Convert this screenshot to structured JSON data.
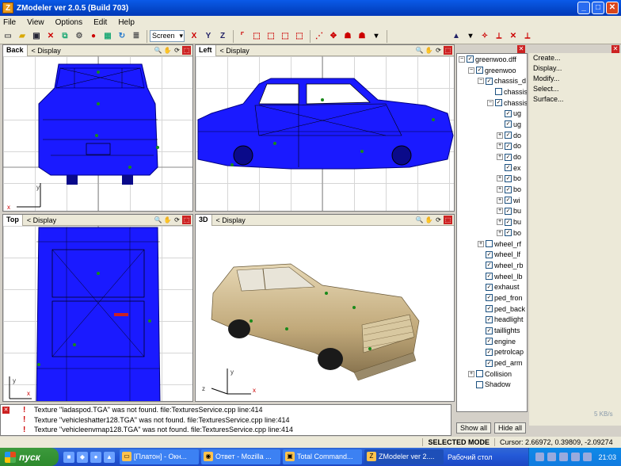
{
  "window": {
    "title": "ZModeler ver 2.0.5 (Build 703)",
    "icon_letter": "Z",
    "btn_min": "_",
    "btn_max": "□",
    "btn_close": "✕"
  },
  "menu": [
    {
      "label": "File"
    },
    {
      "label": "View"
    },
    {
      "label": "Options"
    },
    {
      "label": "Edit"
    },
    {
      "label": "Help"
    }
  ],
  "toolbar": {
    "screen_select": "Screen",
    "axis_x": "X",
    "axis_y": "Y",
    "axis_z": "Z"
  },
  "viewports": {
    "back": {
      "name": "Back",
      "display": "< Display"
    },
    "left": {
      "name": "Left",
      "display": "< Display"
    },
    "top": {
      "name": "Top",
      "display": "< Display"
    },
    "view3d": {
      "name": "3D",
      "display": "< Display"
    }
  },
  "axes": {
    "x": "x",
    "y": "y",
    "z": "z"
  },
  "tree": {
    "rows": [
      {
        "indent": 0,
        "exp": "−",
        "checked": true,
        "label": "greenwoo.dff"
      },
      {
        "indent": 1,
        "exp": "−",
        "checked": true,
        "label": "greenwoo"
      },
      {
        "indent": 2,
        "exp": "−",
        "checked": true,
        "label": "chassis_d"
      },
      {
        "indent": 3,
        "exp": "",
        "checked": false,
        "label": "chassis"
      },
      {
        "indent": 3,
        "exp": "−",
        "checked": true,
        "label": "chassis"
      },
      {
        "indent": 4,
        "exp": "",
        "checked": true,
        "label": "ug"
      },
      {
        "indent": 4,
        "exp": "",
        "checked": true,
        "label": "ug"
      },
      {
        "indent": 4,
        "exp": "+",
        "checked": true,
        "label": "do"
      },
      {
        "indent": 4,
        "exp": "+",
        "checked": true,
        "label": "do"
      },
      {
        "indent": 4,
        "exp": "+",
        "checked": true,
        "label": "do"
      },
      {
        "indent": 4,
        "exp": "",
        "checked": true,
        "label": "ex"
      },
      {
        "indent": 4,
        "exp": "+",
        "checked": true,
        "label": "bo"
      },
      {
        "indent": 4,
        "exp": "+",
        "checked": true,
        "label": "bo"
      },
      {
        "indent": 4,
        "exp": "+",
        "checked": true,
        "label": "wi"
      },
      {
        "indent": 4,
        "exp": "+",
        "checked": true,
        "label": "bu"
      },
      {
        "indent": 4,
        "exp": "+",
        "checked": true,
        "label": "bu"
      },
      {
        "indent": 4,
        "exp": "+",
        "checked": true,
        "label": "bo"
      },
      {
        "indent": 2,
        "exp": "+",
        "checked": false,
        "label": "wheel_rf"
      },
      {
        "indent": 2,
        "exp": "",
        "checked": true,
        "label": "wheel_lf"
      },
      {
        "indent": 2,
        "exp": "",
        "checked": true,
        "label": "wheel_rb"
      },
      {
        "indent": 2,
        "exp": "",
        "checked": true,
        "label": "wheel_lb"
      },
      {
        "indent": 2,
        "exp": "",
        "checked": true,
        "label": "exhaust"
      },
      {
        "indent": 2,
        "exp": "",
        "checked": true,
        "label": "ped_fron"
      },
      {
        "indent": 2,
        "exp": "",
        "checked": true,
        "label": "ped_back"
      },
      {
        "indent": 2,
        "exp": "",
        "checked": true,
        "label": "headlight"
      },
      {
        "indent": 2,
        "exp": "",
        "checked": true,
        "label": "taillights"
      },
      {
        "indent": 2,
        "exp": "",
        "checked": true,
        "label": "engine"
      },
      {
        "indent": 2,
        "exp": "",
        "checked": true,
        "label": "petrolcap"
      },
      {
        "indent": 2,
        "exp": "",
        "checked": true,
        "label": "ped_arm"
      },
      {
        "indent": 1,
        "exp": "+",
        "checked": false,
        "label": "Collision"
      },
      {
        "indent": 1,
        "exp": "",
        "checked": false,
        "label": "Shadow"
      }
    ],
    "show_all": "Show all",
    "hide_all": "Hide all"
  },
  "right_panel": [
    "Create...",
    "Display...",
    "Modify...",
    "Select...",
    "Surface..."
  ],
  "log": [
    "Texture \"ladaspod.TGA\" was not found. file:TexturesService.cpp line:414",
    "Texture \"vehicleshatter128.TGA\" was not found. file:TexturesService.cpp line:414",
    "Texture \"vehicleenvmap128.TGA\" was not found. file:TexturesService.cpp line:414"
  ],
  "status": {
    "mode": "SELECTED MODE",
    "cursor": "Cursor: 2.66972, 0.39809, -2.09274"
  },
  "taskbar": {
    "start": "пуск",
    "tasks": [
      {
        "label": "[Платон] - Окн..."
      },
      {
        "label": "Ответ - Mozilla ..."
      },
      {
        "label": "Total Command..."
      },
      {
        "label": "ZModeler ver 2...."
      },
      {
        "label": "Рабочий стол"
      }
    ],
    "clock": "21:03",
    "net_speed": "5 KB/s"
  },
  "colors": {
    "wire": "#1a1aff",
    "car_body": "#c9b48a",
    "accent": "#cc2222"
  }
}
